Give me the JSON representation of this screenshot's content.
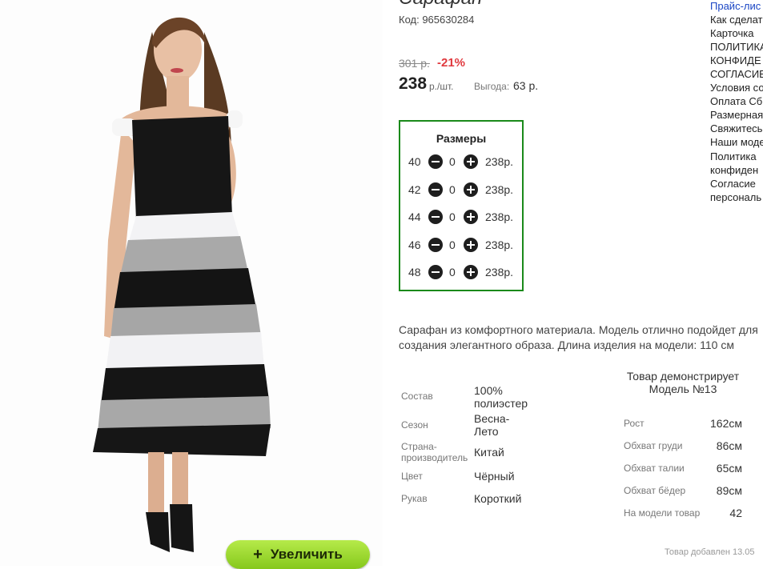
{
  "product": {
    "title": "Сарафан",
    "code": "Код: 965630284",
    "old_price": "301 р.",
    "discount": "-21%",
    "price": "238",
    "price_unit": "р./шт.",
    "benefit_label": "Выгода:",
    "benefit_value": "63 р."
  },
  "zoom_button": {
    "plus": "+",
    "label": "Увеличить"
  },
  "sizes": {
    "title": "Размеры",
    "rows": [
      {
        "size": "40",
        "qty": "0",
        "price": "238р."
      },
      {
        "size": "42",
        "qty": "0",
        "price": "238р."
      },
      {
        "size": "44",
        "qty": "0",
        "price": "238р."
      },
      {
        "size": "46",
        "qty": "0",
        "price": "238р."
      },
      {
        "size": "48",
        "qty": "0",
        "price": "238р."
      }
    ]
  },
  "description": [
    "Сарафан из комфортного материала. Модель отлично подойдет для",
    "создания элегантного образа. Длина изделия на модели: 110 см"
  ],
  "attributes": [
    {
      "label": "Состав",
      "value": "100% полиэстер"
    },
    {
      "label": "Сезон",
      "value": "Весна-Лето"
    },
    {
      "label": "Страна-производитель",
      "value": "Китай"
    },
    {
      "label": "Цвет",
      "value": "Чёрный"
    },
    {
      "label": "Рукав",
      "value": "Короткий"
    }
  ],
  "model": {
    "heading": "Товар демонстрирует Модель №13",
    "measurements": [
      {
        "label": "Рост",
        "value": "162см"
      },
      {
        "label": "Обхват груди",
        "value": "86см"
      },
      {
        "label": "Обхват талии",
        "value": "65см"
      },
      {
        "label": "Обхват бёдер",
        "value": "89см"
      },
      {
        "label": "На модели товар",
        "value": "42"
      }
    ]
  },
  "added_text": "Товар добавлен 13.05",
  "sidebar_links": [
    "Прайс-лис",
    "Как сделат",
    "Карточка",
    "ПОЛИТИКА",
    "КОНФИДЕ",
    "СОГЛАСИЕ",
    "Условия со",
    "Оплата Сб",
    "Размерная",
    "Свяжитесь",
    "Наши моде",
    "Политика",
    "конфиден",
    "Согласие",
    "персональ"
  ],
  "colors": {
    "size_box_border": "#1a8a1a",
    "discount": "#e0393e",
    "zoom_button": "#9ad52e",
    "link_blue": "#1a45c4"
  }
}
